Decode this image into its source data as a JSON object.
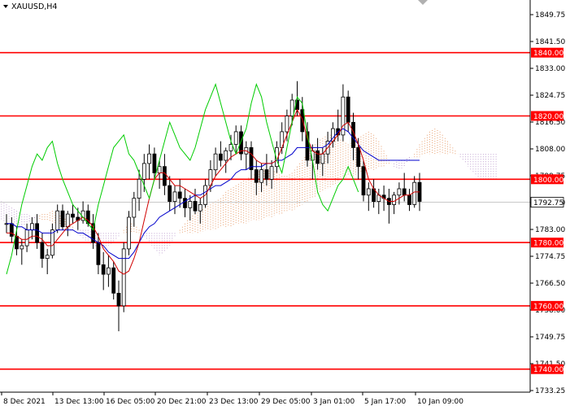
{
  "window": {
    "symbol_label": "XAUUSD,H4",
    "menu_icon": "triangle-down-icon",
    "scroll_icon": "triangle-down-icon"
  },
  "colors": {
    "level": "#ff0000",
    "candle": "#000000",
    "tenkan": "#d00000",
    "kijun": "#0000cc",
    "chikou": "#00cc00",
    "cloud_bull": "#e8a070",
    "cloud_bear": "#c0a0d0",
    "price_line": "#c8c8c8",
    "price_tag": "#000000"
  },
  "chart_data": {
    "type": "candlestick",
    "ylim": [
      1733.25,
      1852.0
    ],
    "y_ticks": [
      "1849.75",
      "1841.50",
      "1833.00",
      "1824.75",
      "1816.50",
      "1808.00",
      "1799.75",
      "1791.50",
      "1783.00",
      "1774.75",
      "1766.50",
      "1758.00",
      "1749.75",
      "1741.50",
      "1733.25"
    ],
    "x_ticks": [
      "8 Dec 2021",
      "13 Dec 13:00",
      "16 Dec 05:00",
      "20 Dec 21:00",
      "23 Dec 13:00",
      "29 Dec 05:00",
      "3 Jan 01:00",
      "5 Jan 17:00",
      "10 Jan 09:00"
    ],
    "current_price": "1792.75",
    "levels": [
      {
        "value": 1840,
        "label": "1840.00"
      },
      {
        "value": 1820,
        "label": "1820.00"
      },
      {
        "value": 1800,
        "label": "1800.00"
      },
      {
        "value": 1780,
        "label": "1780.00"
      },
      {
        "value": 1760,
        "label": "1760.00"
      },
      {
        "value": 1740,
        "label": "1740.00"
      }
    ],
    "candles": [
      [
        1786,
        1789,
        1783,
        1786
      ],
      [
        1786,
        1788,
        1780,
        1782
      ],
      [
        1782,
        1785,
        1776,
        1778
      ],
      [
        1778,
        1781,
        1773,
        1779
      ],
      [
        1779,
        1786,
        1777,
        1784
      ],
      [
        1784,
        1788,
        1781,
        1786
      ],
      [
        1786,
        1789,
        1778,
        1780
      ],
      [
        1780,
        1783,
        1772,
        1775
      ],
      [
        1775,
        1778,
        1770,
        1776
      ],
      [
        1776,
        1786,
        1775,
        1784
      ],
      [
        1784,
        1792,
        1783,
        1790
      ],
      [
        1790,
        1792,
        1784,
        1785
      ],
      [
        1785,
        1790,
        1782,
        1789
      ],
      [
        1789,
        1792,
        1786,
        1788
      ],
      [
        1788,
        1791,
        1784,
        1787
      ],
      [
        1787,
        1793,
        1786,
        1790
      ],
      [
        1790,
        1792,
        1785,
        1786
      ],
      [
        1786,
        1789,
        1778,
        1780
      ],
      [
        1780,
        1783,
        1770,
        1773
      ],
      [
        1773,
        1777,
        1765,
        1770
      ],
      [
        1770,
        1776,
        1766,
        1772
      ],
      [
        1772,
        1774,
        1762,
        1764
      ],
      [
        1764,
        1768,
        1752,
        1760
      ],
      [
        1760,
        1780,
        1758,
        1778
      ],
      [
        1778,
        1790,
        1776,
        1788
      ],
      [
        1788,
        1796,
        1785,
        1794
      ],
      [
        1794,
        1803,
        1790,
        1800
      ],
      [
        1800,
        1808,
        1796,
        1805
      ],
      [
        1805,
        1811,
        1800,
        1808
      ],
      [
        1808,
        1810,
        1800,
        1802
      ],
      [
        1802,
        1806,
        1797,
        1804
      ],
      [
        1804,
        1808,
        1795,
        1798
      ],
      [
        1798,
        1801,
        1790,
        1793
      ],
      [
        1793,
        1798,
        1789,
        1796
      ],
      [
        1796,
        1800,
        1791,
        1794
      ],
      [
        1794,
        1797,
        1788,
        1791
      ],
      [
        1791,
        1795,
        1787,
        1793
      ],
      [
        1793,
        1797,
        1789,
        1790
      ],
      [
        1790,
        1794,
        1786,
        1792
      ],
      [
        1792,
        1800,
        1791,
        1798
      ],
      [
        1798,
        1806,
        1796,
        1803
      ],
      [
        1803,
        1810,
        1801,
        1808
      ],
      [
        1808,
        1812,
        1804,
        1806
      ],
      [
        1806,
        1810,
        1802,
        1809
      ],
      [
        1809,
        1814,
        1806,
        1811
      ],
      [
        1811,
        1817,
        1808,
        1815
      ],
      [
        1815,
        1817,
        1806,
        1808
      ],
      [
        1808,
        1812,
        1803,
        1810
      ],
      [
        1810,
        1812,
        1800,
        1803
      ],
      [
        1803,
        1806,
        1795,
        1799
      ],
      [
        1799,
        1805,
        1796,
        1803
      ],
      [
        1803,
        1808,
        1798,
        1800
      ],
      [
        1800,
        1806,
        1797,
        1804
      ],
      [
        1804,
        1812,
        1802,
        1810
      ],
      [
        1810,
        1818,
        1808,
        1815
      ],
      [
        1815,
        1822,
        1812,
        1820
      ],
      [
        1820,
        1827,
        1817,
        1825
      ],
      [
        1825,
        1831,
        1820,
        1822
      ],
      [
        1822,
        1826,
        1812,
        1815
      ],
      [
        1815,
        1818,
        1804,
        1806
      ],
      [
        1806,
        1811,
        1800,
        1809
      ],
      [
        1809,
        1813,
        1803,
        1805
      ],
      [
        1805,
        1810,
        1801,
        1808
      ],
      [
        1808,
        1815,
        1805,
        1812
      ],
      [
        1812,
        1818,
        1810,
        1816
      ],
      [
        1816,
        1822,
        1812,
        1814
      ],
      [
        1814,
        1830,
        1812,
        1826
      ],
      [
        1826,
        1828,
        1815,
        1818
      ],
      [
        1818,
        1821,
        1806,
        1810
      ],
      [
        1810,
        1813,
        1800,
        1804
      ],
      [
        1804,
        1806,
        1793,
        1795
      ],
      [
        1795,
        1799,
        1790,
        1797
      ],
      [
        1797,
        1800,
        1791,
        1793
      ],
      [
        1793,
        1797,
        1789,
        1795
      ],
      [
        1795,
        1798,
        1790,
        1794
      ],
      [
        1794,
        1797,
        1786,
        1792
      ],
      [
        1792,
        1796,
        1789,
        1795
      ],
      [
        1795,
        1799,
        1792,
        1797
      ],
      [
        1797,
        1802,
        1793,
        1795
      ],
      [
        1795,
        1797,
        1790,
        1792
      ],
      [
        1792,
        1801,
        1791,
        1799
      ],
      [
        1799,
        1802,
        1790,
        1793
      ]
    ],
    "tenkan": [
      1783,
      1783,
      1782,
      1781,
      1781,
      1782,
      1782,
      1781,
      1779,
      1779,
      1781,
      1783,
      1785,
      1786,
      1787,
      1788,
      1787,
      1785,
      1782,
      1778,
      1776,
      1774,
      1771,
      1770,
      1771,
      1775,
      1780,
      1787,
      1794,
      1800,
      1802,
      1802,
      1800,
      1798,
      1798,
      1797,
      1796,
      1795,
      1794,
      1795,
      1798,
      1801,
      1803,
      1805,
      1807,
      1808,
      1809,
      1809,
      1808,
      1806,
      1805,
      1805,
      1805,
      1806,
      1810,
      1814,
      1818,
      1822,
      1819,
      1813,
      1809,
      1808,
      1808,
      1810,
      1812,
      1814,
      1817,
      1818,
      1815,
      1811,
      1806,
      1800,
      1797,
      1795,
      1794,
      1793,
      1793,
      1794,
      1795,
      1795,
      1796,
      1796
    ],
    "kijun": [
      1786,
      1786,
      1785,
      1785,
      1784,
      1784,
      1784,
      1783,
      1783,
      1783,
      1784,
      1784,
      1784,
      1784,
      1783,
      1783,
      1782,
      1781,
      1780,
      1779,
      1777,
      1776,
      1775,
      1775,
      1775,
      1777,
      1780,
      1783,
      1785,
      1786,
      1788,
      1789,
      1790,
      1791,
      1792,
      1793,
      1794,
      1795,
      1795,
      1796,
      1797,
      1798,
      1798,
      1799,
      1800,
      1802,
      1803,
      1803,
      1804,
      1804,
      1804,
      1805,
      1805,
      1806,
      1806,
      1807,
      1808,
      1810,
      1810,
      1810,
      1810,
      1810,
      1810,
      1811,
      1813,
      1815,
      1816,
      1815,
      1813,
      1811,
      1809,
      1808,
      1807,
      1806,
      1806,
      1806,
      1806,
      1806,
      1806,
      1806,
      1806,
      1806
    ],
    "chikou": [
      1770,
      1776,
      1784,
      1792,
      1798,
      1804,
      1808,
      1806,
      1810,
      1812,
      1805,
      1800,
      1796,
      1792,
      1790,
      1788,
      1786,
      1784,
      1792,
      1798,
      1804,
      1810,
      1812,
      1814,
      1808,
      1806,
      1802,
      1798,
      1794,
      1800,
      1806,
      1812,
      1818,
      1814,
      1810,
      1808,
      1806,
      1810,
      1816,
      1822,
      1826,
      1830,
      1824,
      1818,
      1812,
      1808,
      1812,
      1816,
      1824,
      1830,
      1826,
      1818,
      1812,
      1806,
      1802,
      1810,
      1818,
      1826,
      1824,
      1814,
      1806,
      1796,
      1792,
      1790,
      1794,
      1798,
      1800,
      1804,
      1800,
      1796
    ],
    "cloud_a": [
      1790,
      1790,
      1789,
      1788,
      1787,
      1787,
      1786,
      1786,
      1785,
      1785,
      1786,
      1787,
      1788,
      1789,
      1789,
      1790,
      1789,
      1788,
      1787,
      1785,
      1783,
      1781,
      1780,
      1779,
      1778,
      1778,
      1779,
      1780,
      1782,
      1784,
      1786,
      1786,
      1784,
      1782,
      1780,
      1778,
      1776,
      1777,
      1779,
      1782,
      1784,
      1786,
      1788,
      1789,
      1790,
      1791,
      1792,
      1793,
      1794,
      1796,
      1797,
      1798,
      1799,
      1800,
      1801,
      1802,
      1803,
      1804,
      1803,
      1802,
      1801,
      1801,
      1802,
      1804,
      1806,
      1808,
      1810,
      1812,
      1813,
      1814,
      1814,
      1813,
      1812,
      1811,
      1812,
      1813,
      1814,
      1815,
      1814,
      1812,
      1809,
      1806,
      1804,
      1803,
      1804,
      1806,
      1808,
      1811,
      1813,
      1815,
      1816,
      1815,
      1813,
      1811,
      1809,
      1807,
      1805,
      1803,
      1801,
      1800,
      1800,
      1800,
      1800
    ],
    "cloud_b": [
      1795,
      1795,
      1795,
      1794,
      1794,
      1793,
      1792,
      1791,
      1790,
      1789,
      1789,
      1788,
      1788,
      1787,
      1787,
      1786,
      1786,
      1785,
      1785,
      1784,
      1784,
      1784,
      1784,
      1783,
      1783,
      1783,
      1783,
      1783,
      1783,
      1783,
      1783,
      1783,
      1783,
      1783,
      1783,
      1783,
      1783,
      1783,
      1783,
      1783,
      1783,
      1783,
      1783,
      1783,
      1783,
      1784,
      1784,
      1784,
      1785,
      1785,
      1785,
      1786,
      1786,
      1786,
      1787,
      1787,
      1787,
      1788,
      1788,
      1789,
      1789,
      1790,
      1790,
      1791,
      1792,
      1793,
      1794,
      1795,
      1796,
      1797,
      1798,
      1799,
      1800,
      1801,
      1801,
      1802,
      1802,
      1803,
      1803,
      1804,
      1804,
      1805,
      1805,
      1806,
      1806,
      1807,
      1807,
      1807,
      1808,
      1808,
      1808,
      1808,
      1808,
      1808,
      1808,
      1808,
      1808,
      1808,
      1808,
      1808,
      1808,
      1808,
      1808
    ]
  }
}
